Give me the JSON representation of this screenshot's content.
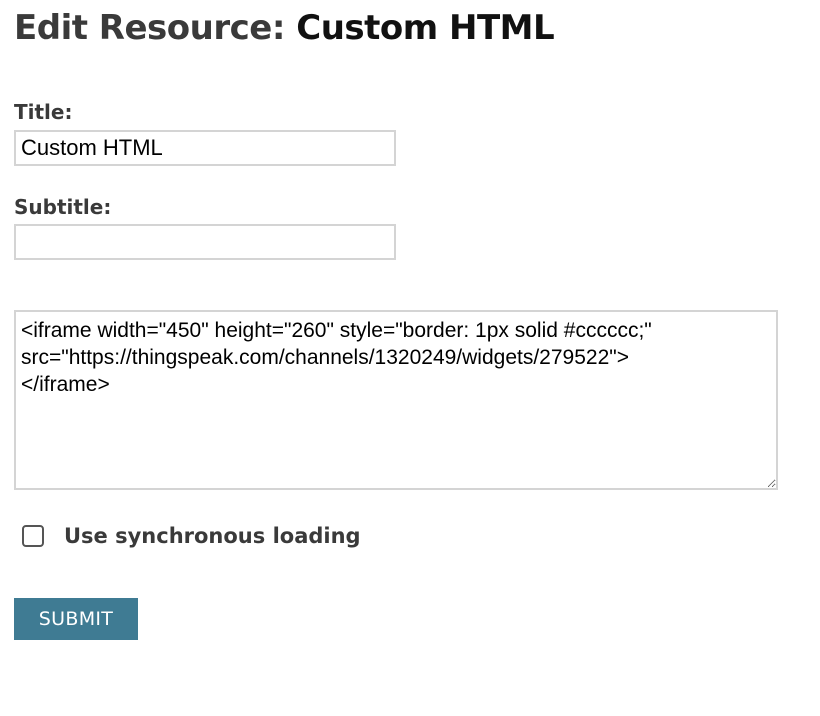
{
  "page": {
    "title_prefix": "Edit Resource: ",
    "title_name": "Custom HTML"
  },
  "form": {
    "title_label": "Title:",
    "title_value": "Custom HTML",
    "subtitle_label": "Subtitle:",
    "subtitle_value": "",
    "html_code": "<iframe width=\"450\" height=\"260\" style=\"border: 1px solid #cccccc;\"\nsrc=\"https://thingspeak.com/channels/1320249/widgets/279522\">\n</iframe>",
    "sync_loading_label": "Use synchronous loading",
    "sync_loading_checked": false,
    "submit_label": "SUBMIT"
  },
  "colors": {
    "submit_background": "#3f7b93",
    "field_border": "#d4d4d4",
    "label_text": "#3a3a3a"
  }
}
